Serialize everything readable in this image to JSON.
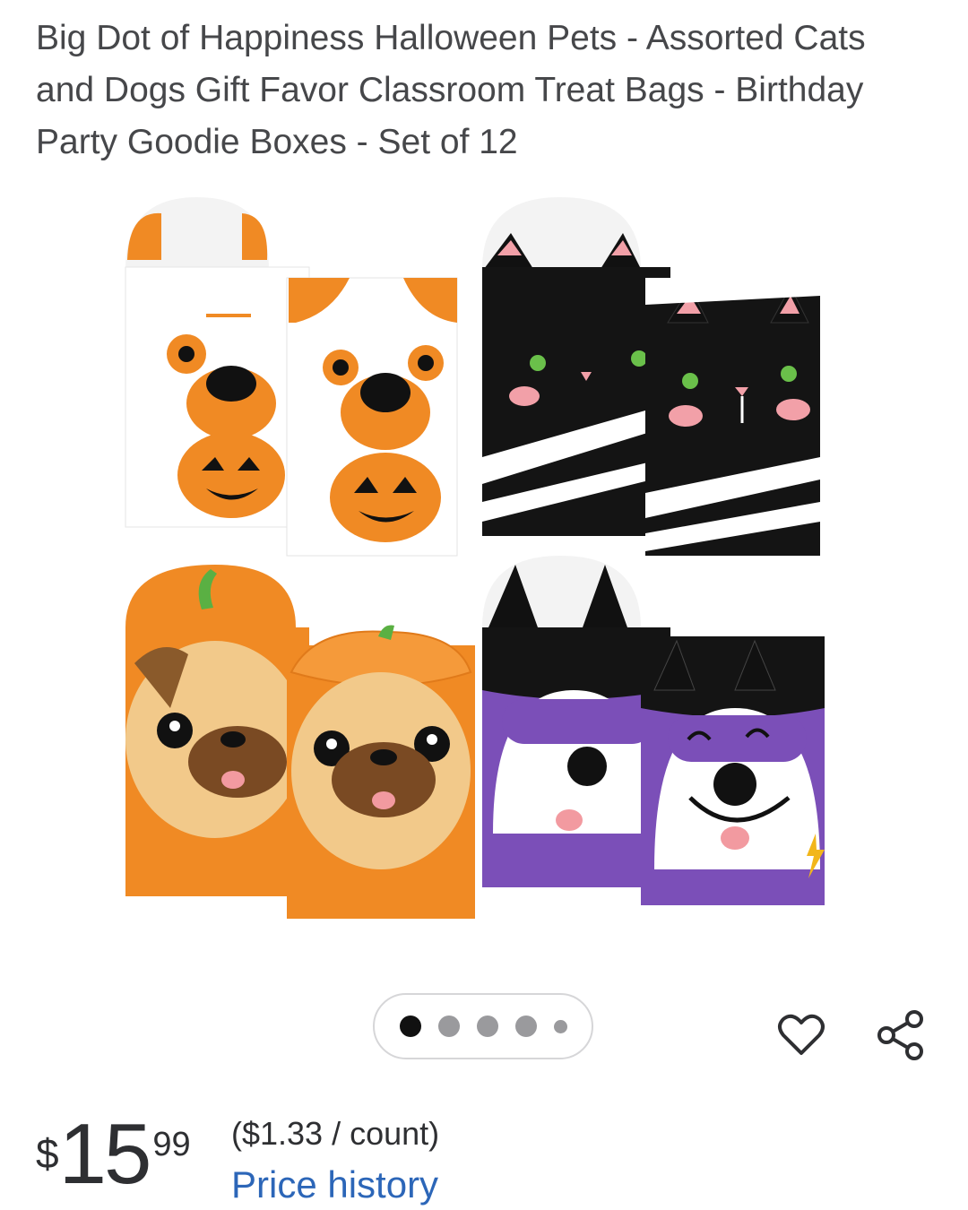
{
  "product": {
    "title": "Big Dot of Happiness Halloween Pets - Assorted Cats and Dogs Gift Favor Classroom Treat Bags - Birthday Party Goodie Boxes - Set of 12",
    "image": {
      "icon": "product-photo-treat-bags"
    },
    "carousel": {
      "count": 5,
      "active_index": 0
    },
    "actions": {
      "favorite_icon": "heart-icon",
      "share_icon": "share-icon"
    },
    "price": {
      "currency": "$",
      "dollars": "15",
      "cents": "99",
      "unit_price": "($1.33 / count)",
      "price_history_link": "Price history"
    }
  },
  "colors": {
    "text": "#2e2f32",
    "link": "#2c66b8",
    "orange": "#f08a24",
    "purple": "#7b4fb8",
    "black": "#141414"
  }
}
